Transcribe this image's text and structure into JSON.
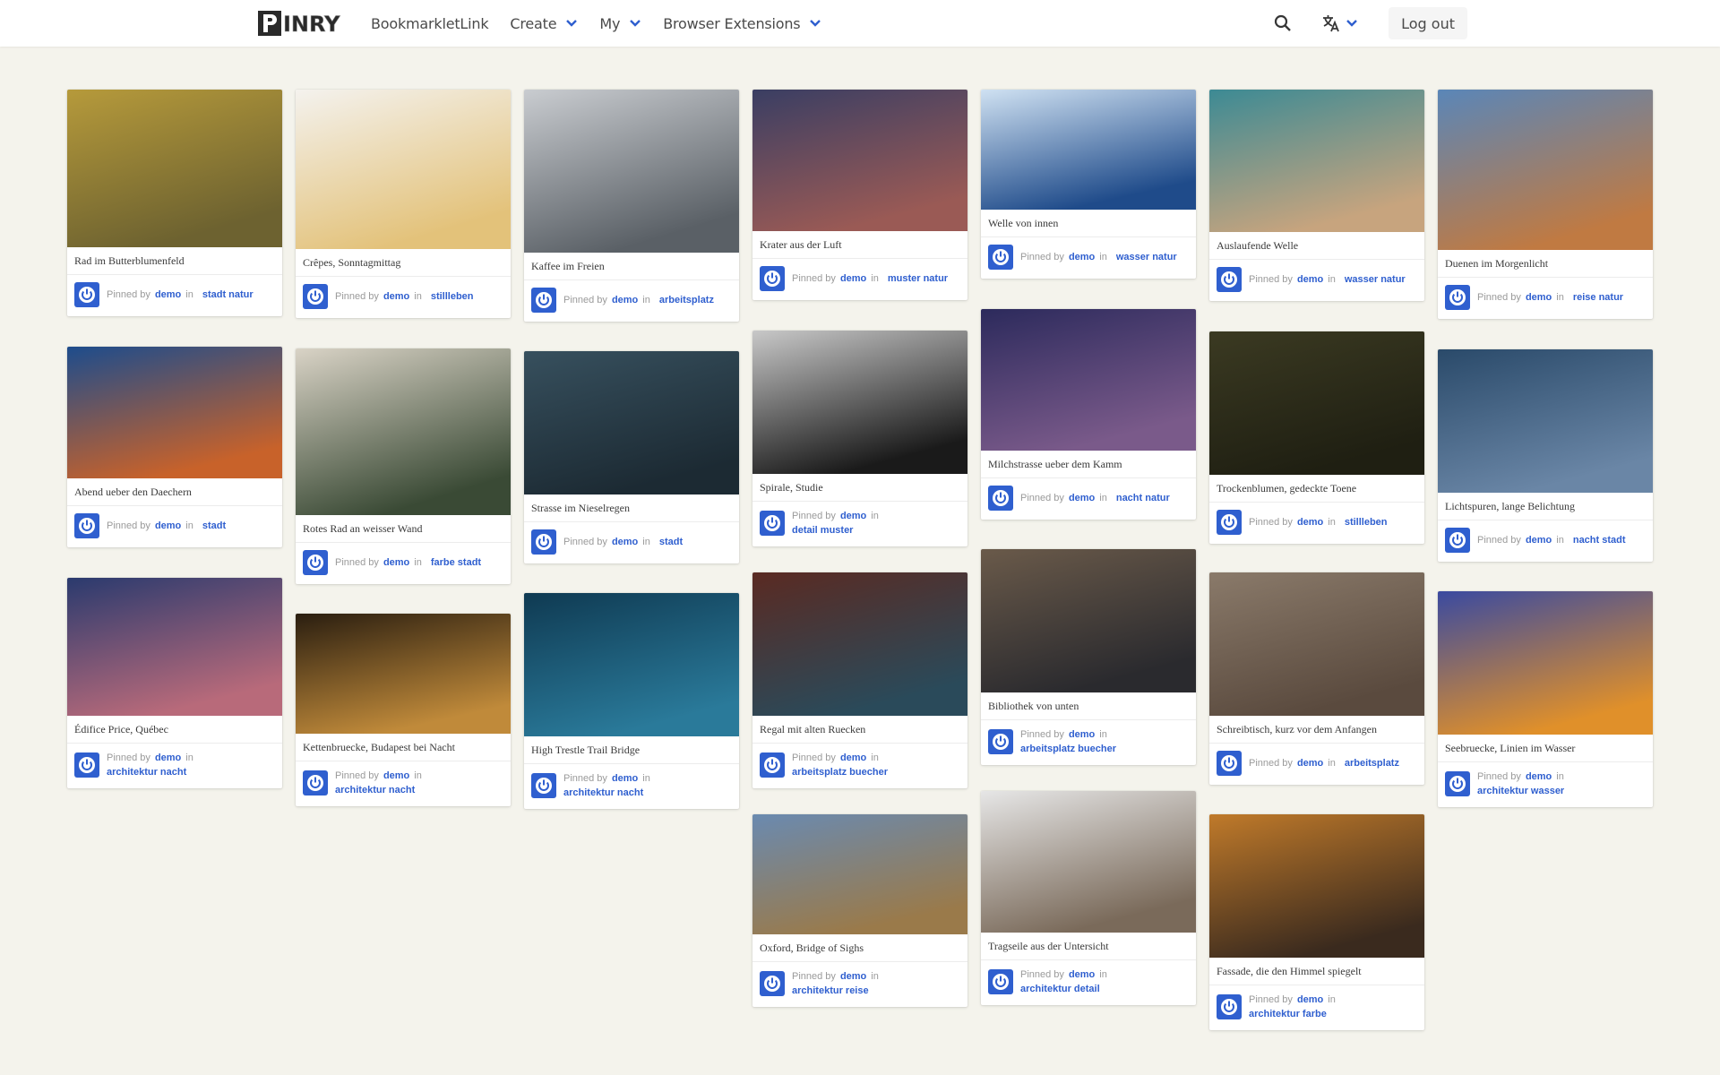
{
  "nav": {
    "logo_text": "PINRY",
    "bookmarklet": "BookmarkletLink",
    "create": "Create",
    "my": "My",
    "extensions": "Browser Extensions",
    "logout": "Log out",
    "search_icon": "search-icon",
    "language_icon": "translate-icon",
    "accent": "#2f5fcf"
  },
  "meta_labels": {
    "pinned_by": "Pinned by",
    "in": "in"
  },
  "pins": [
    {
      "title": "Rad im Butterblumenfeld",
      "user": "demo",
      "boards": "stadt natur",
      "c1": "#b69a3b",
      "c2": "#6d6230"
    },
    {
      "title": "Crêpes, Sonntagmittag",
      "user": "demo",
      "boards": "stillleben",
      "c1": "#f4f2ee",
      "c2": "#e3c27a"
    },
    {
      "title": "Kaffee im Freien",
      "user": "demo",
      "boards": "arbeitsplatz",
      "c1": "#c9ccd0",
      "c2": "#5a6066"
    },
    {
      "title": "Krater aus der Luft",
      "user": "demo",
      "boards": "muster natur",
      "c1": "#3a3e63",
      "c2": "#9a5a55"
    },
    {
      "title": "Welle von innen",
      "user": "demo",
      "boards": "wasser natur",
      "c1": "#cfe1f2",
      "c2": "#1f4b8a"
    },
    {
      "title": "Auslaufende Welle",
      "user": "demo",
      "boards": "wasser natur",
      "c1": "#3c8a94",
      "c2": "#c7a47e"
    },
    {
      "title": "Duenen im Morgenlicht",
      "user": "demo",
      "boards": "reise natur",
      "c1": "#5a86b8",
      "c2": "#c07a42"
    },
    {
      "title": "Abend ueber den Daechern",
      "user": "demo",
      "boards": "stadt",
      "c1": "#1d4c8c",
      "c2": "#c8622a"
    },
    {
      "title": "Rotes Rad an weisser Wand",
      "user": "demo",
      "boards": "farbe stadt",
      "c1": "#d9d3c6",
      "c2": "#3a4a35"
    },
    {
      "title": "Strasse im Nieselregen",
      "user": "demo",
      "boards": "stadt",
      "c1": "#37505e",
      "c2": "#1c2a33"
    },
    {
      "title": "Spirale, Studie",
      "user": "demo",
      "boards": "detail muster",
      "c1": "#c8c8c8",
      "c2": "#1a1a1a"
    },
    {
      "title": "Milchstrasse ueber dem Kamm",
      "user": "demo",
      "boards": "nacht natur",
      "c1": "#2c2a5c",
      "c2": "#7a5a8a"
    },
    {
      "title": "Trockenblumen, gedeckte Toene",
      "user": "demo",
      "boards": "stillleben",
      "c1": "#3b3a22",
      "c2": "#1f1f12"
    },
    {
      "title": "Lichtspuren, lange Belichtung",
      "user": "demo",
      "boards": "nacht stadt",
      "c1": "#2a4a6a",
      "c2": "#6a86a6"
    },
    {
      "title": "Édifice Price, Québec",
      "user": "demo",
      "boards": "architektur nacht",
      "c1": "#2a3a6e",
      "c2": "#b86a7a"
    },
    {
      "title": "Kettenbruecke, Budapest bei Nacht",
      "user": "demo",
      "boards": "architektur nacht",
      "c1": "#2a1e10",
      "c2": "#c08a3a"
    },
    {
      "title": "High Trestle Trail Bridge",
      "user": "demo",
      "boards": "architektur nacht",
      "c1": "#0f3a52",
      "c2": "#2a7a9a"
    },
    {
      "title": "Regal mit alten Ruecken",
      "user": "demo",
      "boards": "arbeitsplatz buecher",
      "c1": "#5a2a22",
      "c2": "#2a4a5a"
    },
    {
      "title": "Bibliothek von unten",
      "user": "demo",
      "boards": "arbeitsplatz buecher",
      "c1": "#6a5a4a",
      "c2": "#2a2a2e"
    },
    {
      "title": "Schreibtisch, kurz vor dem Anfangen",
      "user": "demo",
      "boards": "arbeitsplatz",
      "c1": "#8a7a6a",
      "c2": "#5a4a3e"
    },
    {
      "title": "Seebruecke, Linien im Wasser",
      "user": "demo",
      "boards": "architektur wasser",
      "c1": "#3a4aa0",
      "c2": "#e0902a"
    },
    {
      "title": "Oxford, Bridge of Sighs",
      "user": "demo",
      "boards": "architektur reise",
      "c1": "#6a8ab0",
      "c2": "#9a7a4a"
    },
    {
      "title": "Tragseile aus der Untersicht",
      "user": "demo",
      "boards": "architektur detail",
      "c1": "#e6e6e6",
      "c2": "#7a6a5a"
    },
    {
      "title": "Fassade, die den Himmel spiegelt",
      "user": "demo",
      "boards": "architektur farbe",
      "c1": "#c07a2a",
      "c2": "#3a2a1e"
    }
  ]
}
